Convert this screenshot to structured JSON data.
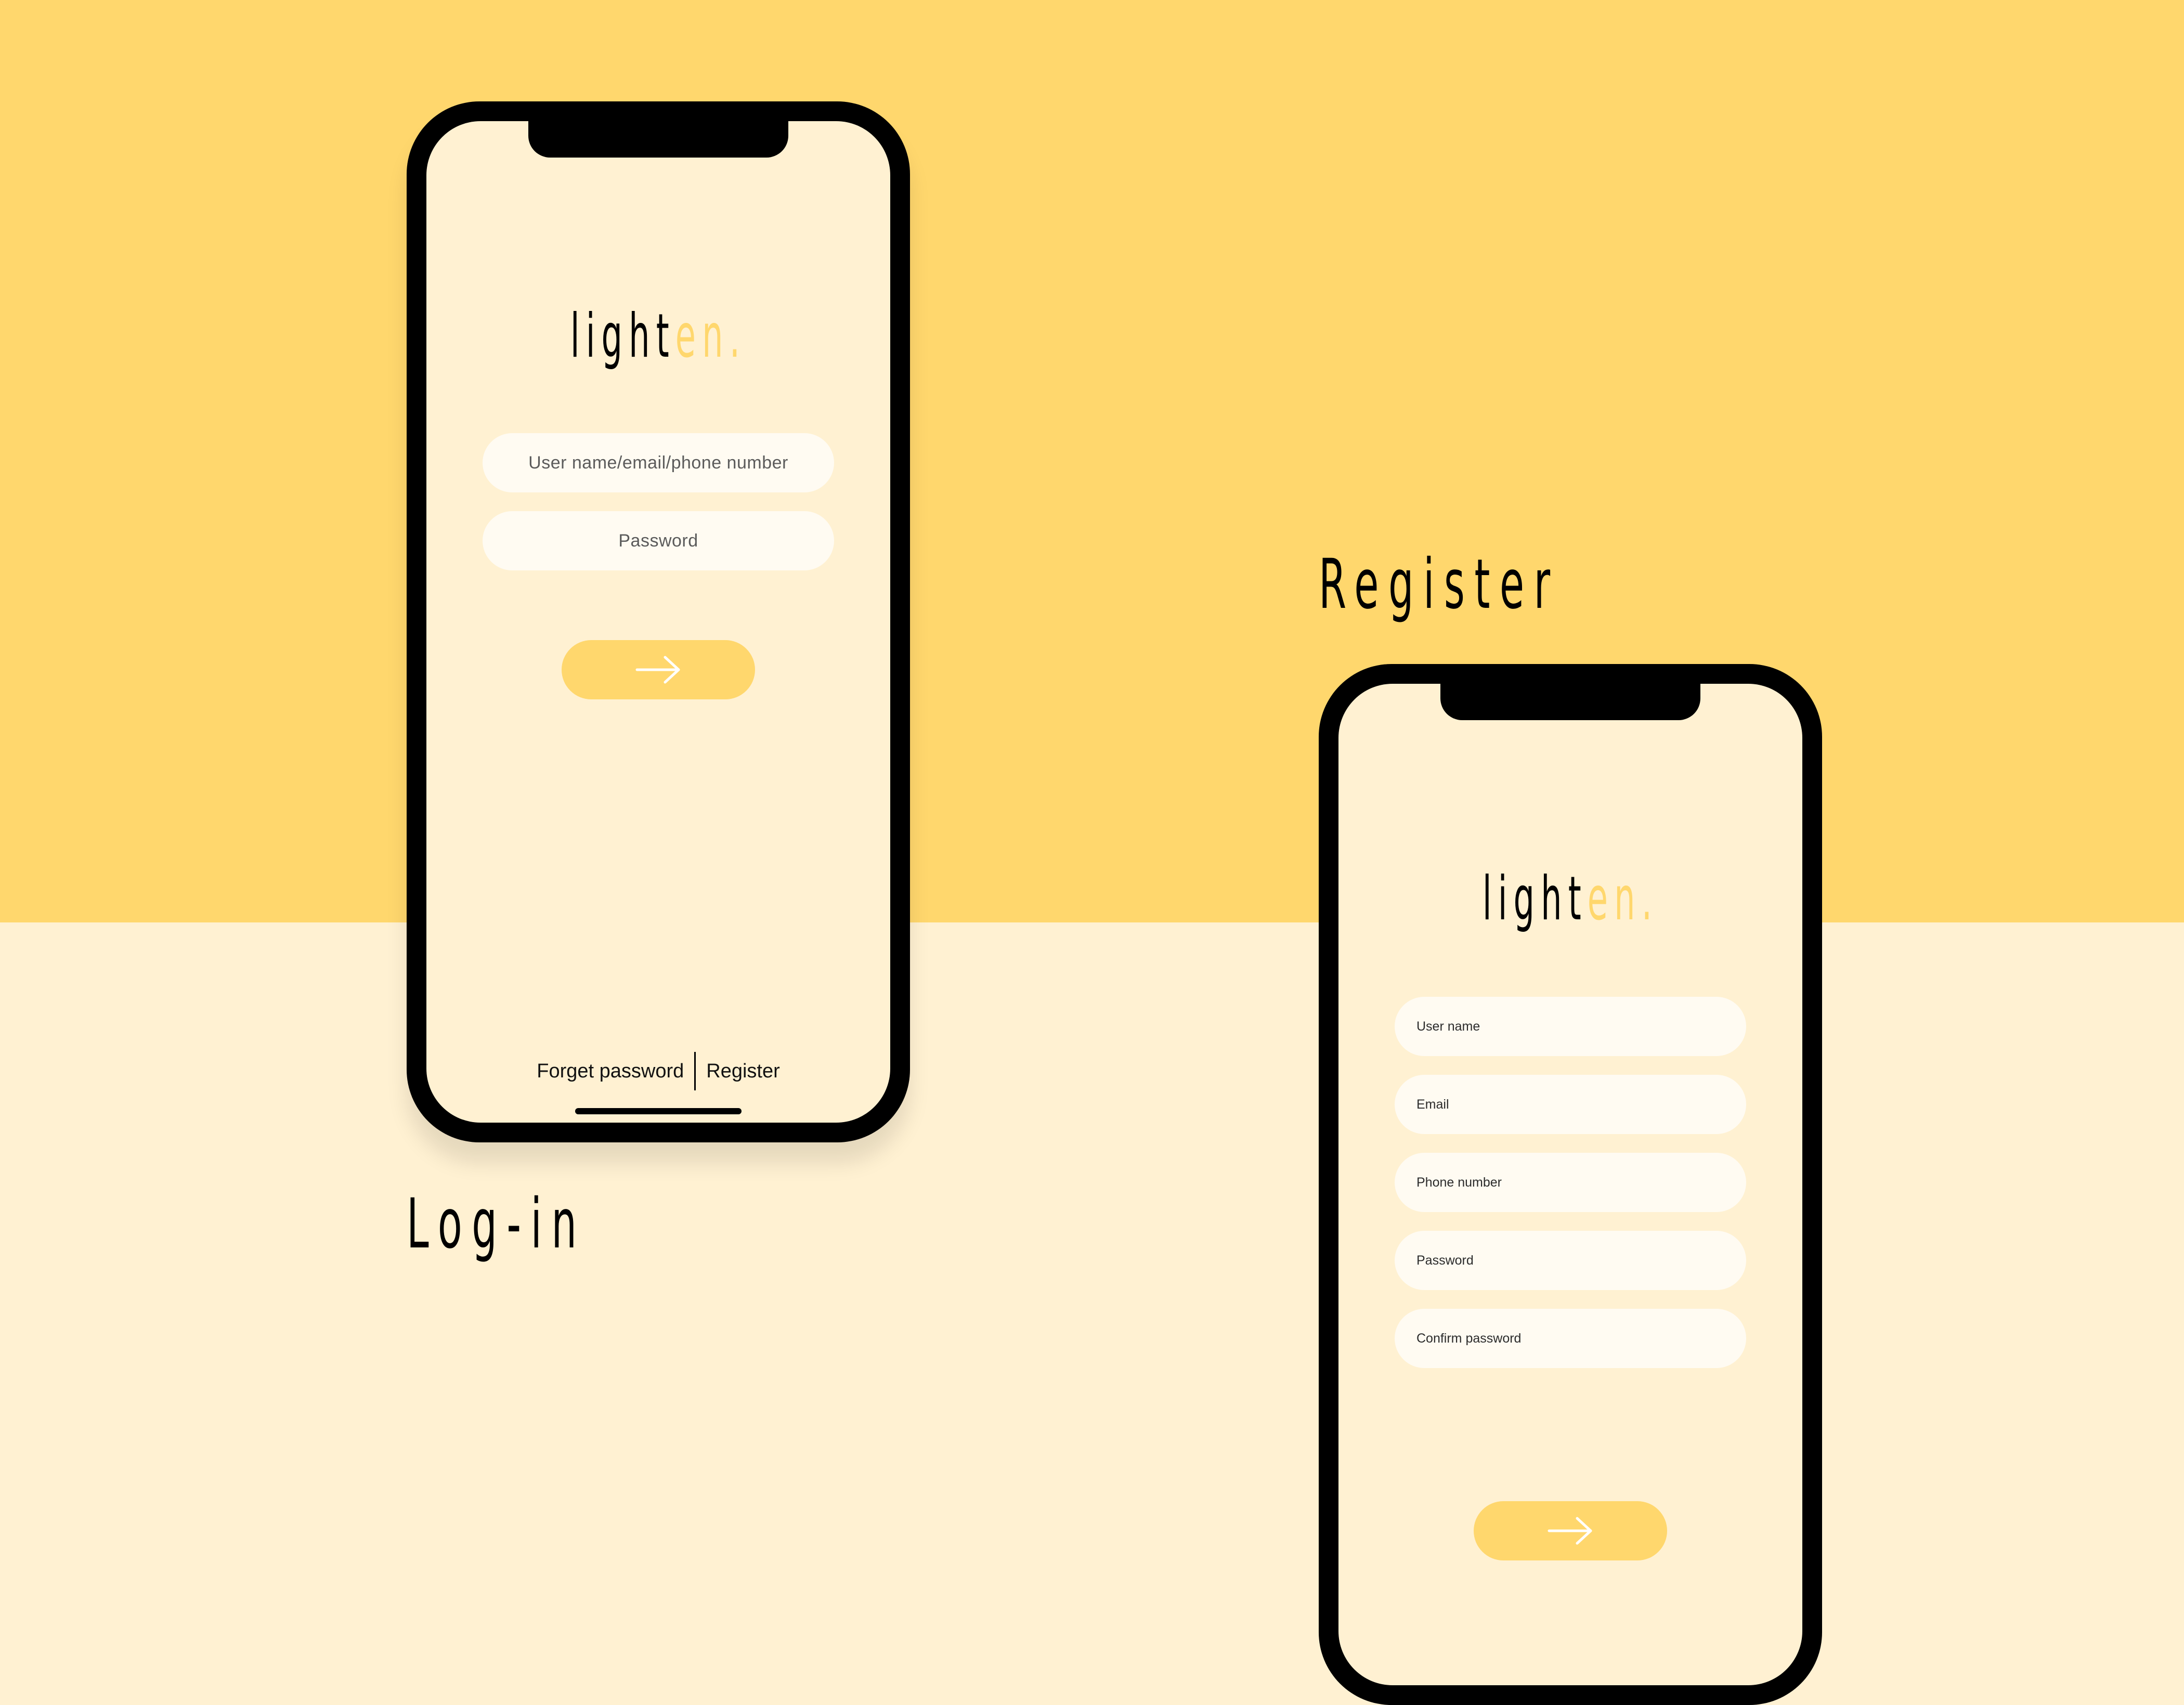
{
  "captions": {
    "login": "Log-in",
    "register": "Register"
  },
  "logo": {
    "dark_part": "light",
    "accent_part": "en."
  },
  "login_screen": {
    "username_placeholder": "User name/email/phone number",
    "password_placeholder": "Password",
    "submit_icon": "arrow-right-icon",
    "forget_password_label": "Forget password",
    "register_label": "Register"
  },
  "register_screen": {
    "fields": {
      "username": "User name",
      "email": "Email",
      "phone": "Phone number",
      "password": "Password",
      "confirm_password": "Confirm password"
    },
    "submit_icon": "arrow-right-icon"
  },
  "colors": {
    "accent_yellow": "#FFD76D",
    "cream": "#FFF1D2",
    "input_bg": "#FFFBF2",
    "frame": "#000000"
  }
}
